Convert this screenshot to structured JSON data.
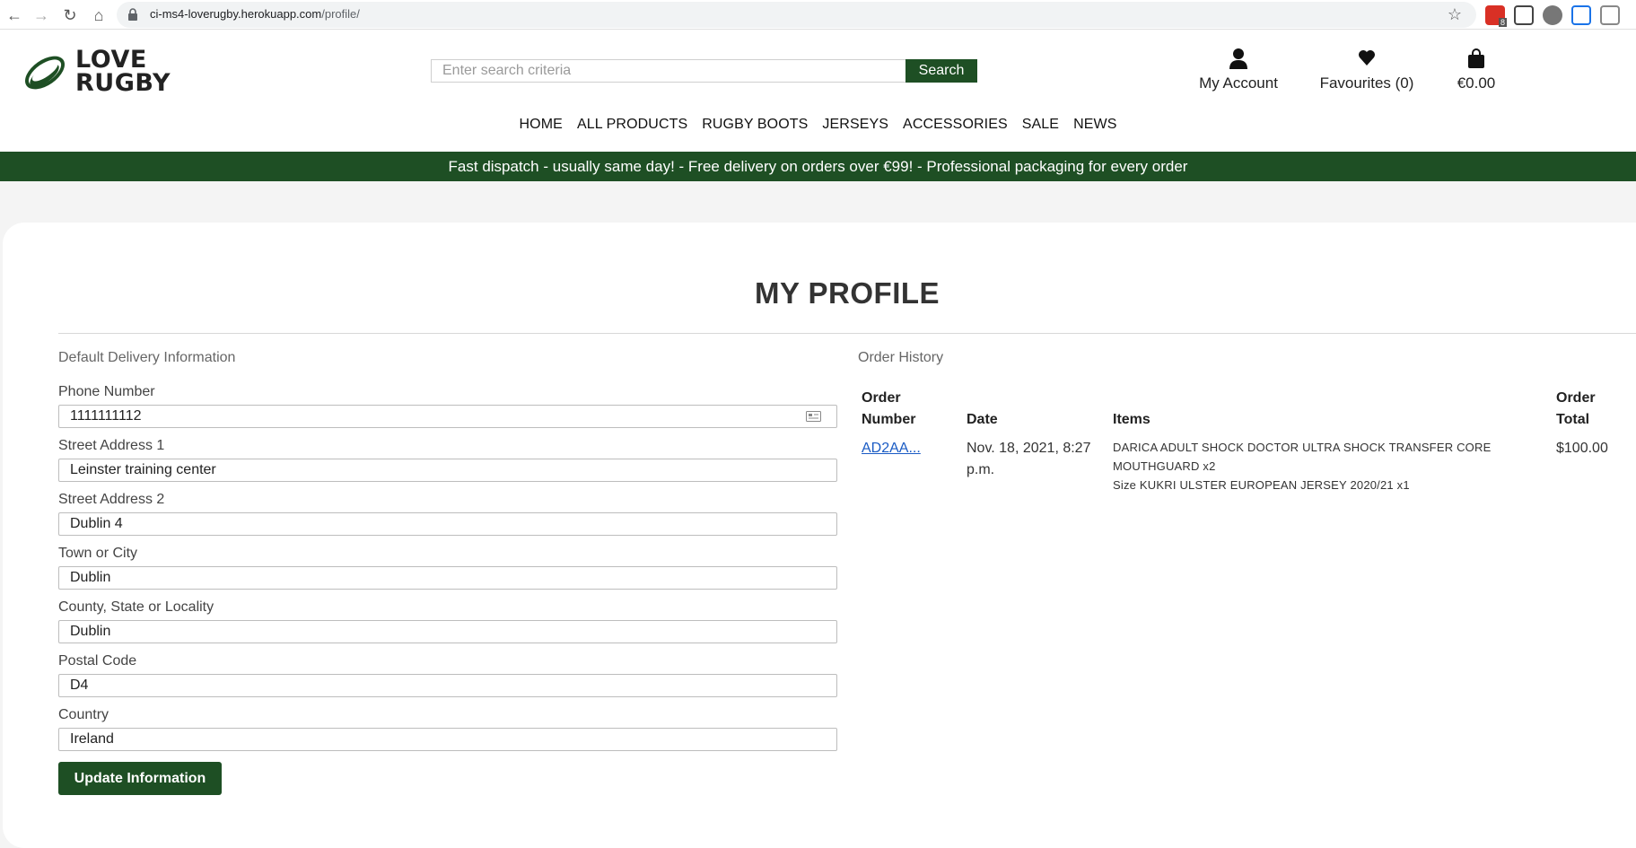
{
  "browser": {
    "url_host": "ci-ms4-loverugby.herokuapp.com",
    "url_path": "/profile/",
    "ext_badge": "8"
  },
  "header": {
    "logo_line1": "LOVE",
    "logo_line2": "RUGBY",
    "search_placeholder": "Enter search criteria",
    "search_button": "Search",
    "account_label": "My Account",
    "favourites_label": "Favourites (0)",
    "cart_label": "€0.00"
  },
  "nav": {
    "items": [
      "HOME",
      "ALL PRODUCTS",
      "RUGBY BOOTS",
      "JERSEYS",
      "ACCESSORIES",
      "SALE",
      "NEWS"
    ]
  },
  "banner": {
    "text": "Fast dispatch - usually same day! - Free delivery on orders over €99! - Professional packaging for every order"
  },
  "profile": {
    "title": "MY PROFILE",
    "delivery_heading": "Default Delivery Information",
    "fields": [
      {
        "label": "Phone Number",
        "value": "1111111112"
      },
      {
        "label": "Street Address 1",
        "value": "Leinster training center"
      },
      {
        "label": "Street Address 2",
        "value": "Dublin 4"
      },
      {
        "label": "Town or City",
        "value": "Dublin"
      },
      {
        "label": "County, State or Locality",
        "value": "Dublin"
      },
      {
        "label": "Postal Code",
        "value": "D4"
      },
      {
        "label": "Country",
        "value": "Ireland"
      }
    ],
    "update_button": "Update Information"
  },
  "orders": {
    "heading": "Order History",
    "columns": {
      "order_number_1": "Order",
      "order_number_2": "Number",
      "date": "Date",
      "items": "Items",
      "total_1": "Order",
      "total_2": "Total"
    },
    "rows": [
      {
        "order_number": "AD2AA...",
        "date_1": "Nov. 18, 2021, 8:27",
        "date_2": "p.m.",
        "items": [
          "DARICA ADULT SHOCK DOCTOR ULTRA SHOCK TRANSFER CORE",
          "MOUTHGUARD x2",
          "Size KUKRI ULSTER EUROPEAN JERSEY 2020/21 x1"
        ],
        "total": "$100.00"
      }
    ]
  },
  "colors": {
    "brand_green": "#1e4f24",
    "link_blue": "#1a5bc4"
  }
}
